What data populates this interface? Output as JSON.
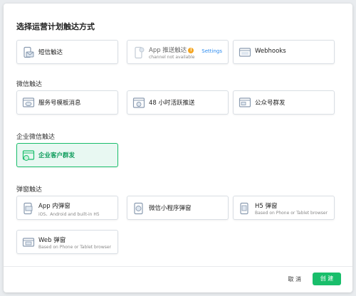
{
  "dialog": {
    "title": "选择运营计划触达方式",
    "cancel_label": "取 消",
    "create_label": "创 建"
  },
  "sections": {
    "wechat": "微信触达",
    "enterprise_wechat": "企业微信触达",
    "popup": "弹窗触达"
  },
  "cards": {
    "sms": {
      "label": "短信触达",
      "icon": "sms-icon"
    },
    "app_push": {
      "label": "App 推送触达",
      "sub": "channel not available",
      "settings": "Settings",
      "warn": "!",
      "icon": "app-push-icon"
    },
    "webhooks": {
      "label": "Webhooks",
      "icon": "webhook-icon"
    },
    "service_template": {
      "label": "服务号模板消息",
      "icon": "wechat-template-icon"
    },
    "active_push_48h": {
      "label": "48 小时活跃推送",
      "icon": "wechat-active-icon"
    },
    "official_mass": {
      "label": "公众号群发",
      "icon": "official-account-icon"
    },
    "enterprise_mass": {
      "label": "企业客户群发",
      "icon": "enterprise-customer-icon"
    },
    "app_popup": {
      "label": "App 内弹窗",
      "sub": "iOS、Android and built-in H5",
      "icon": "app-popup-icon"
    },
    "mini_program_popup": {
      "label": "微信小程序弹窗",
      "icon": "mini-program-icon"
    },
    "h5_popup": {
      "label": "H5 弹窗",
      "sub": "Based on  Phone or Tablet browser",
      "icon": "h5-popup-icon"
    },
    "web_popup": {
      "label": "Web 弹窗",
      "sub": "Based on  Phone or Tablet browser",
      "icon": "web-popup-icon"
    }
  },
  "colors": {
    "accent": "#19be6b",
    "link": "#2d8cf0",
    "icon": "#8a9bb0"
  }
}
